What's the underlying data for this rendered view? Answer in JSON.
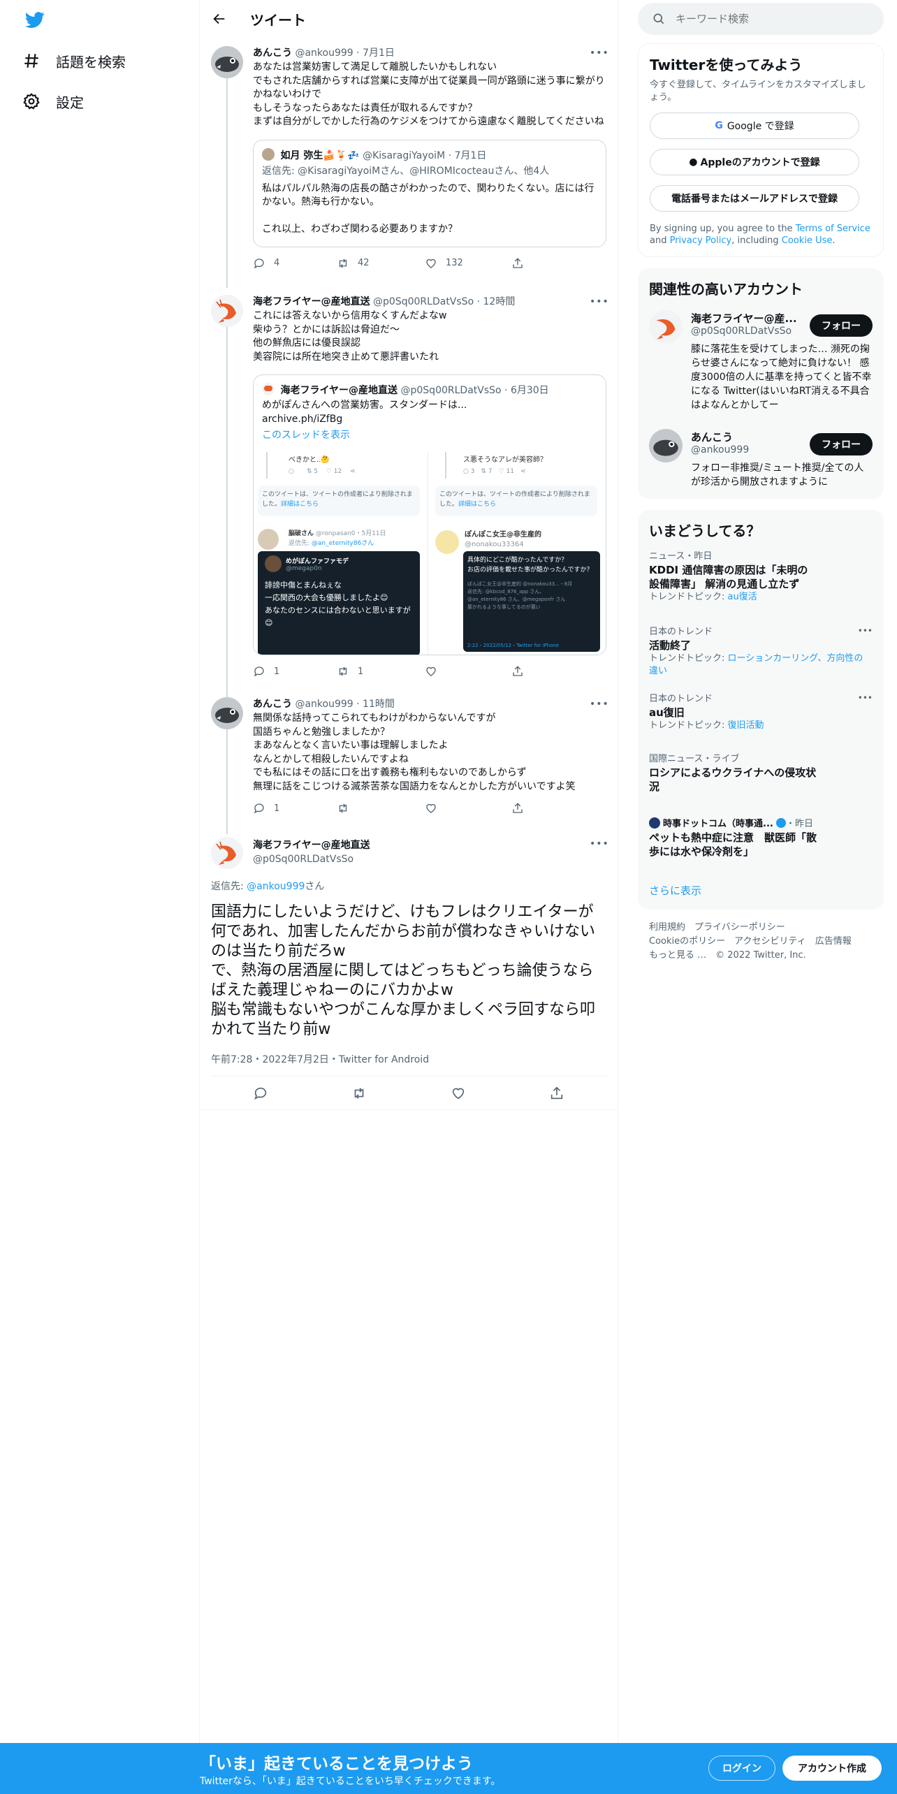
{
  "nav": {
    "explore": "話題を検索",
    "settings": "設定"
  },
  "header": {
    "title": "ツイート"
  },
  "tweets": [
    {
      "name": "あんこう",
      "handle": "@ankou999",
      "time": "7月1日",
      "text": "あなたは営業妨害して満足して離脱したいかもしれない\nでもされた店舗からすれば営業に支障が出て従業員一同が路頭に迷う事に繋がりかねないわけで\nもしそうなったらあなたは責任が取れるんですか？\nまずは自分がしでかした行為のケジメをつけてから遠慮なく離脱してくださいね",
      "quote": {
        "name": "如月 弥生🍰🍹💤",
        "handle": "@KisaragiYayoiM",
        "time": "7月1日",
        "reply_to": "返信先: @KisaragiYayoiMさん、@HIROMIcocteauさん、他4人",
        "text": "私はパルパル熱海の店長の酷さがわかったので、関わりたくない。店には行かない。熱海も行かない。\n\nこれ以上、わざわざ関わる必要ありますか？"
      },
      "counts": {
        "reply": "4",
        "retweet": "42",
        "like": "132"
      }
    },
    {
      "name": "海老フライヤー@産地直送",
      "handle": "@p0Sq00RLDatVsSo",
      "time": "12時間",
      "text": "これには答えないから信用なくすんだよなw\n柴ゆう？とかには訴訟は脅迫だ〜\n他の鮮魚店には優良誤認\n美容院には所在地突き止めて悪評書いたれ",
      "quote": {
        "name": "海老フライヤー@産地直送",
        "handle": "@p0Sq00RLDatVsSo",
        "time": "6月30日",
        "text": "めがぽんさんへの営業妨害。スタンダードは...\narchive.ph/iZfBg",
        "thread_link": "このスレッドを表示",
        "img": {
          "l_top": "べきかと..🤔",
          "l_c1": "5",
          "l_c2": "12",
          "r_top": "ス悪そうなアレが美容師？",
          "r_c1": "3",
          "r_c2": "7",
          "r_c3": "11",
          "deleted": "このツイートは、ツイートの作成者により削除されました。",
          "deleted_link": "詳細はこちら",
          "l_user": "脳破さん",
          "l_handle": "@ronpasan0・5月11日",
          "l_reply": "返信先:",
          "l_reply_to": "@an_eternity86さん",
          "l_inner_name": "めがぽんファファモデ",
          "l_inner_handle": "@megap0n",
          "l_inner_text": "誹謗中傷とまんねぇな\n一応関西の大会も優勝しましたよ😊\nあなたのセンスには合わないと思いますが😊",
          "r_user": "ぽんぽこ女王@非生産的",
          "r_handle": "@nonakou33364",
          "r_inner_text": "具体的にどこが酷かったんですか？\nお店の評価を載せた事が酷かったんですか？",
          "r_inner_quote": "ぽんぽこ女王@非生産的 @nonakou33...・8月\n返信先: @kbcod_876_app さん、\n@an_eternity86 さん、@megaponfr さん\n悪かれるような事してるのが悪い",
          "r_footer": "2:22・2022/05/12・Twitter for iPhone"
        }
      },
      "counts": {
        "reply": "1",
        "retweet": "1",
        "like": ""
      }
    },
    {
      "name": "あんこう",
      "handle": "@ankou999",
      "time": "11時間",
      "text": "無関係な話持ってこられてもわけがわからないんですが\n国語ちゃんと勉強しましたか？\nまあなんとなく言いたい事は理解しましたよ\nなんとかして相殺したいんですよね\nでも私にはその話に口を出す義務も権利もないのであしからず\n無理に話をこじつける滅茶苦茶な国語力をなんとかした方がいいですよ笑",
      "counts": {
        "reply": "1",
        "retweet": "",
        "like": ""
      }
    }
  ],
  "focus": {
    "name": "海老フライヤー@産地直送",
    "handle": "@p0Sq00RLDatVsSo",
    "reply_prefix": "返信先: ",
    "reply_handle": "@ankou999",
    "reply_suffix": "さん",
    "text": "国語力にしたいようだけど、けもフレはクリエイターが何であれ、加害したんだからお前が償わなきゃいけないのは当たり前だろw\nで、熱海の居酒屋に関してはどっちもどっち論使うならばえた義理じゃねーのにバカかよw\n脳も常識もないやつがこんな厚かましくペラ回すなら叩かれて当たり前w",
    "meta": "午前7:28・2022年7月2日・Twitter for Android"
  },
  "search": {
    "placeholder": "キーワード検索"
  },
  "signup": {
    "title": "Twitterを使ってみよう",
    "sub": "今すぐ登録して、タイムラインをカスタマイズしましょう。",
    "google": "Google で登録",
    "apple": "Appleのアカウントで登録",
    "phone": "電話番号またはメールアドレスで登録",
    "terms_pre": "By signing up, you agree to the ",
    "terms": "Terms of Service",
    "and": " and ",
    "privacy": "Privacy Policy",
    "including": ", including ",
    "cookie": "Cookie Use",
    "dot": "."
  },
  "related": {
    "title": "関連性の高いアカウント",
    "follow": "フォロー",
    "accounts": [
      {
        "name": "海老フライヤー@産...",
        "handle": "@p0Sq00RLDatVsSo",
        "bio": "膝に落花生を受けてしまった… 瀕死の掬らせ婆さんになって絶対に負けない！ 感度3000倍の人に基準を持ってくと皆不幸になる Twitter(はいいねRT消える不具合はよなんとかしてー"
      },
      {
        "name": "あんこう",
        "handle": "@ankou999",
        "bio": "フォロー非推奨/ミュート推奨/全ての人が珍活から開放されますように"
      }
    ]
  },
  "trends": {
    "title": "いまどうしてる？",
    "more": "さらに表示",
    "items": [
      {
        "meta": "ニュース・昨日",
        "title": "KDDI 通信障害の原因は「未明の設備障害」 解消の見通し立たず",
        "topic_label": "トレンドトピック: ",
        "topic": "au復活"
      },
      {
        "meta": "日本のトレンド",
        "title": "活動終了",
        "topic_label": "トレンドトピック: ",
        "topic": "ローションカーリング、方向性の違い"
      },
      {
        "meta": "日本のトレンド",
        "title": "au復旧",
        "topic_label": "トレンドトピック: ",
        "topic": "復旧活動"
      },
      {
        "meta": "国際ニュース・ライブ",
        "title": "ロシアによるウクライナへの侵攻状況"
      },
      {
        "source": "時事ドットコム（時事通...",
        "time": "・昨日",
        "title": "ペットも熱中症に注意　獣医師「散歩には水や保冷剤を」"
      }
    ]
  },
  "footer": {
    "l1": "利用規約",
    "l2": "プライバシーポリシー",
    "l3": "Cookieのポリシー",
    "l4": "アクセシビリティ",
    "l5": "広告情報",
    "l6": "もっと見る …",
    "copy": "© 2022 Twitter, Inc."
  },
  "bottom": {
    "title": "「いま」起きていることを見つけよう",
    "sub": "Twitterなら、「いま」起きていることをいち早くチェックできます。",
    "login": "ログイン",
    "signup": "アカウント作成"
  },
  "colors": {
    "accent": "#1d9bf0",
    "text": "#0f1419",
    "muted": "#536471"
  }
}
